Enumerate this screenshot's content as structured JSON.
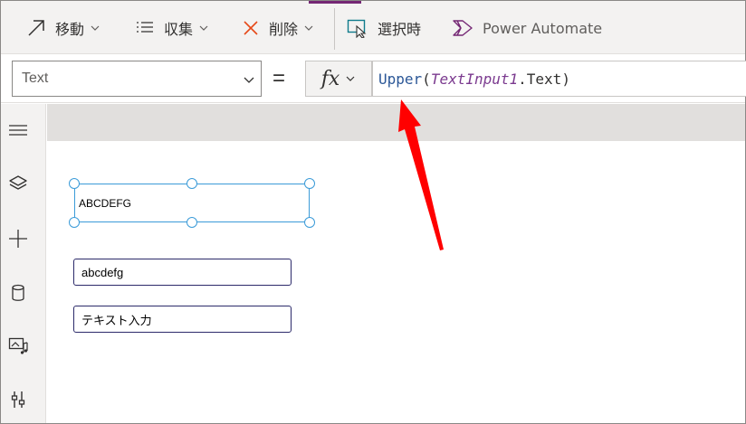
{
  "toolbar": {
    "move_label": "移動",
    "collect_label": "収集",
    "delete_label": "削除",
    "select_label": "選択時",
    "power_automate_label": "Power Automate"
  },
  "formula_bar": {
    "property": "Text",
    "equals": "=",
    "fx": "fx",
    "formula": {
      "fn": "Upper",
      "open": "(",
      "control": "TextInput1",
      "prop": ".Text",
      "close": ")"
    }
  },
  "canvas": {
    "label_value": "ABCDEFG",
    "text_input1_value": "abcdefg",
    "text_input2_value": "テキスト入力"
  },
  "colors": {
    "accent": "#742774",
    "selection": "#3b9bd8",
    "arrow": "#ff0000",
    "input_border": "#2c2a6a"
  }
}
